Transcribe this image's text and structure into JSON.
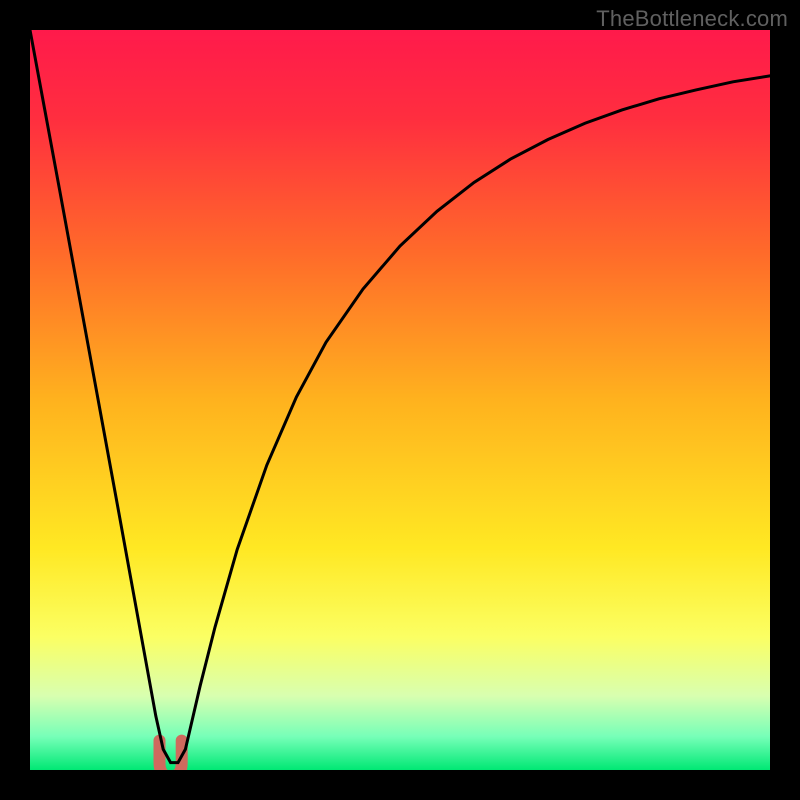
{
  "watermark": "TheBottleneck.com",
  "gradient": {
    "stops": [
      {
        "offset": 0.0,
        "color": "#ff1a4b"
      },
      {
        "offset": 0.12,
        "color": "#ff2e3f"
      },
      {
        "offset": 0.3,
        "color": "#ff6a2a"
      },
      {
        "offset": 0.5,
        "color": "#ffb21e"
      },
      {
        "offset": 0.7,
        "color": "#ffe823"
      },
      {
        "offset": 0.82,
        "color": "#fbff63"
      },
      {
        "offset": 0.9,
        "color": "#d8ffb0"
      },
      {
        "offset": 0.955,
        "color": "#76ffb8"
      },
      {
        "offset": 1.0,
        "color": "#00e874"
      }
    ]
  },
  "chart_data": {
    "type": "line",
    "title": "",
    "xlabel": "",
    "ylabel": "",
    "xlim": [
      0,
      100
    ],
    "ylim": [
      0,
      100
    ],
    "series": [
      {
        "name": "bottleneck-curve",
        "x": [
          0,
          2,
          4,
          6,
          8,
          10,
          12,
          14,
          16,
          17,
          18,
          19,
          20,
          21,
          23,
          25,
          28,
          32,
          36,
          40,
          45,
          50,
          55,
          60,
          65,
          70,
          75,
          80,
          85,
          90,
          95,
          100
        ],
        "y": [
          100,
          89.2,
          78.4,
          67.5,
          56.6,
          45.7,
          34.8,
          23.8,
          12.8,
          7.3,
          2.8,
          1.0,
          1.0,
          2.8,
          11.4,
          19.3,
          29.8,
          41.2,
          50.4,
          57.8,
          65.0,
          70.8,
          75.5,
          79.4,
          82.6,
          85.2,
          87.4,
          89.2,
          90.7,
          91.9,
          93.0,
          93.8
        ]
      }
    ],
    "marker": {
      "x_range": [
        17.5,
        20.5
      ],
      "y": 1.0
    },
    "marker_color": "#cf6a5e"
  }
}
